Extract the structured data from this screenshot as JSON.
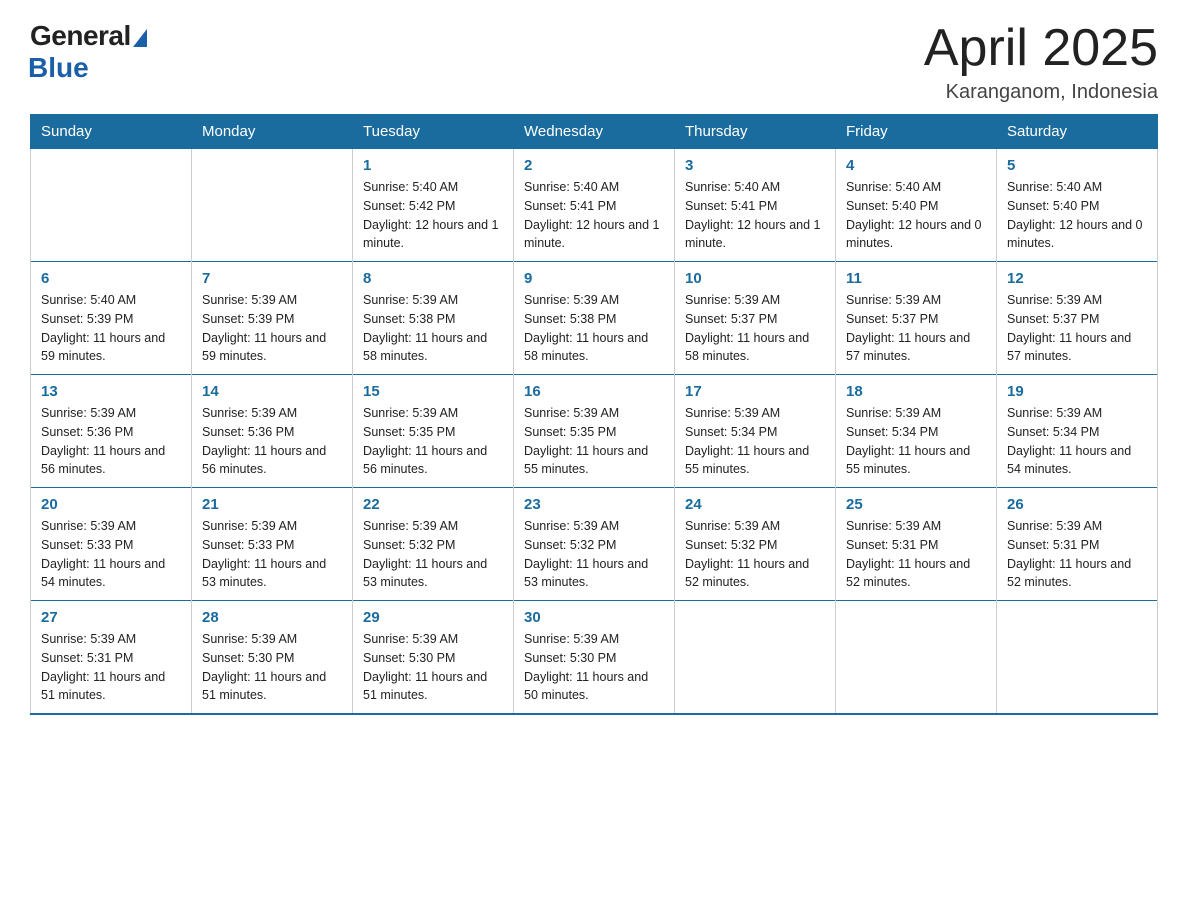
{
  "logo": {
    "general": "General",
    "blue": "Blue"
  },
  "title": {
    "month": "April 2025",
    "location": "Karanganom, Indonesia"
  },
  "days_header": [
    "Sunday",
    "Monday",
    "Tuesday",
    "Wednesday",
    "Thursday",
    "Friday",
    "Saturday"
  ],
  "weeks": [
    [
      {
        "day": "",
        "info": ""
      },
      {
        "day": "",
        "info": ""
      },
      {
        "day": "1",
        "info": "Sunrise: 5:40 AM\nSunset: 5:42 PM\nDaylight: 12 hours\nand 1 minute."
      },
      {
        "day": "2",
        "info": "Sunrise: 5:40 AM\nSunset: 5:41 PM\nDaylight: 12 hours\nand 1 minute."
      },
      {
        "day": "3",
        "info": "Sunrise: 5:40 AM\nSunset: 5:41 PM\nDaylight: 12 hours\nand 1 minute."
      },
      {
        "day": "4",
        "info": "Sunrise: 5:40 AM\nSunset: 5:40 PM\nDaylight: 12 hours\nand 0 minutes."
      },
      {
        "day": "5",
        "info": "Sunrise: 5:40 AM\nSunset: 5:40 PM\nDaylight: 12 hours\nand 0 minutes."
      }
    ],
    [
      {
        "day": "6",
        "info": "Sunrise: 5:40 AM\nSunset: 5:39 PM\nDaylight: 11 hours\nand 59 minutes."
      },
      {
        "day": "7",
        "info": "Sunrise: 5:39 AM\nSunset: 5:39 PM\nDaylight: 11 hours\nand 59 minutes."
      },
      {
        "day": "8",
        "info": "Sunrise: 5:39 AM\nSunset: 5:38 PM\nDaylight: 11 hours\nand 58 minutes."
      },
      {
        "day": "9",
        "info": "Sunrise: 5:39 AM\nSunset: 5:38 PM\nDaylight: 11 hours\nand 58 minutes."
      },
      {
        "day": "10",
        "info": "Sunrise: 5:39 AM\nSunset: 5:37 PM\nDaylight: 11 hours\nand 58 minutes."
      },
      {
        "day": "11",
        "info": "Sunrise: 5:39 AM\nSunset: 5:37 PM\nDaylight: 11 hours\nand 57 minutes."
      },
      {
        "day": "12",
        "info": "Sunrise: 5:39 AM\nSunset: 5:37 PM\nDaylight: 11 hours\nand 57 minutes."
      }
    ],
    [
      {
        "day": "13",
        "info": "Sunrise: 5:39 AM\nSunset: 5:36 PM\nDaylight: 11 hours\nand 56 minutes."
      },
      {
        "day": "14",
        "info": "Sunrise: 5:39 AM\nSunset: 5:36 PM\nDaylight: 11 hours\nand 56 minutes."
      },
      {
        "day": "15",
        "info": "Sunrise: 5:39 AM\nSunset: 5:35 PM\nDaylight: 11 hours\nand 56 minutes."
      },
      {
        "day": "16",
        "info": "Sunrise: 5:39 AM\nSunset: 5:35 PM\nDaylight: 11 hours\nand 55 minutes."
      },
      {
        "day": "17",
        "info": "Sunrise: 5:39 AM\nSunset: 5:34 PM\nDaylight: 11 hours\nand 55 minutes."
      },
      {
        "day": "18",
        "info": "Sunrise: 5:39 AM\nSunset: 5:34 PM\nDaylight: 11 hours\nand 55 minutes."
      },
      {
        "day": "19",
        "info": "Sunrise: 5:39 AM\nSunset: 5:34 PM\nDaylight: 11 hours\nand 54 minutes."
      }
    ],
    [
      {
        "day": "20",
        "info": "Sunrise: 5:39 AM\nSunset: 5:33 PM\nDaylight: 11 hours\nand 54 minutes."
      },
      {
        "day": "21",
        "info": "Sunrise: 5:39 AM\nSunset: 5:33 PM\nDaylight: 11 hours\nand 53 minutes."
      },
      {
        "day": "22",
        "info": "Sunrise: 5:39 AM\nSunset: 5:32 PM\nDaylight: 11 hours\nand 53 minutes."
      },
      {
        "day": "23",
        "info": "Sunrise: 5:39 AM\nSunset: 5:32 PM\nDaylight: 11 hours\nand 53 minutes."
      },
      {
        "day": "24",
        "info": "Sunrise: 5:39 AM\nSunset: 5:32 PM\nDaylight: 11 hours\nand 52 minutes."
      },
      {
        "day": "25",
        "info": "Sunrise: 5:39 AM\nSunset: 5:31 PM\nDaylight: 11 hours\nand 52 minutes."
      },
      {
        "day": "26",
        "info": "Sunrise: 5:39 AM\nSunset: 5:31 PM\nDaylight: 11 hours\nand 52 minutes."
      }
    ],
    [
      {
        "day": "27",
        "info": "Sunrise: 5:39 AM\nSunset: 5:31 PM\nDaylight: 11 hours\nand 51 minutes."
      },
      {
        "day": "28",
        "info": "Sunrise: 5:39 AM\nSunset: 5:30 PM\nDaylight: 11 hours\nand 51 minutes."
      },
      {
        "day": "29",
        "info": "Sunrise: 5:39 AM\nSunset: 5:30 PM\nDaylight: 11 hours\nand 51 minutes."
      },
      {
        "day": "30",
        "info": "Sunrise: 5:39 AM\nSunset: 5:30 PM\nDaylight: 11 hours\nand 50 minutes."
      },
      {
        "day": "",
        "info": ""
      },
      {
        "day": "",
        "info": ""
      },
      {
        "day": "",
        "info": ""
      }
    ]
  ]
}
